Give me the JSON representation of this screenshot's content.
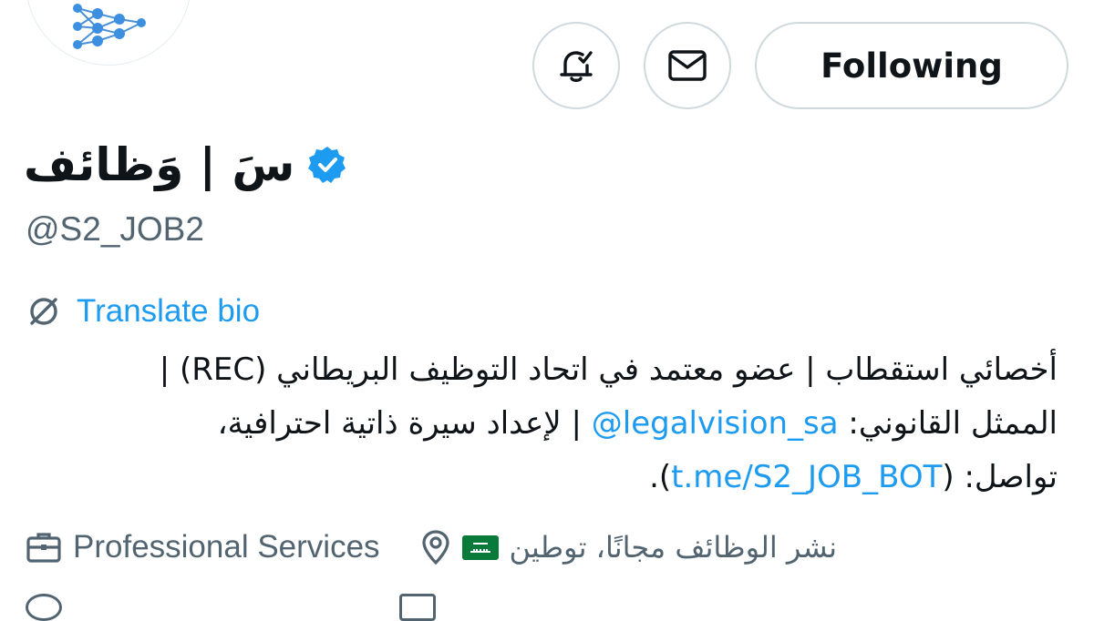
{
  "profile": {
    "display_name": "سَ | وَظائف",
    "handle": "@S2_JOB2",
    "verified": true
  },
  "actions": {
    "notifications_icon": "bell-check-icon",
    "message_icon": "mail-icon",
    "follow_label": "Following"
  },
  "translate": {
    "label": "Translate bio",
    "icon": "translate-icon"
  },
  "bio": {
    "line1": "أخصائي استقطاب | عضو معتمد في اتحاد التوظيف البريطاني (REC) |",
    "line2_prefix": "الممثل القانوني: ",
    "line2_mention": "@legalvision_sa",
    "line2_suffix": " | لإعداد سيرة ذاتية احترافية،",
    "line3_prefix": "تواصل: (",
    "line3_link": "t.me/S2_JOB_BOT",
    "line3_suffix": ")."
  },
  "meta": {
    "category": "Professional Services",
    "location": "نشر الوظائف مجانًا، توطين",
    "category_icon": "briefcase-icon",
    "location_icon": "location-pin-icon",
    "flag_icon": "saudi-flag-icon"
  },
  "colors": {
    "accent": "#1d9bf0",
    "text": "#0f1419",
    "secondary": "#536471",
    "border": "#cfd9de"
  }
}
